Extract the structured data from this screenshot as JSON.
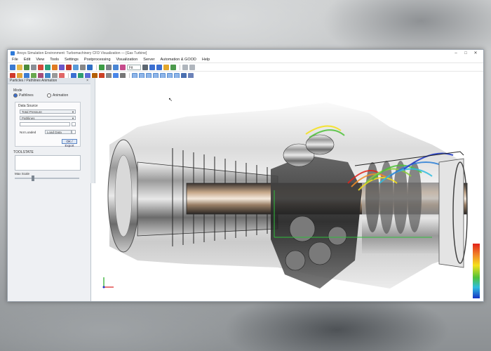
{
  "window": {
    "title": "Ansys Simulation Environment: Turbomachinery CFD Visualization — [Gas Turbine]",
    "controls": {
      "minimize": "–",
      "maximize": "□",
      "close": "✕"
    }
  },
  "menu": [
    "File",
    "Edit",
    "View",
    "Tools",
    "Settings",
    "Postprocessing",
    "Visualization",
    "Server",
    "Automation & GOOD",
    "Help"
  ],
  "toolbar": {
    "dropdown_value": "Fit"
  },
  "left_panel": {
    "header": "Particles / Pathlines Animation",
    "close": "×",
    "mode_label": "Mode",
    "radio_options": [
      "Pathlines",
      "Animation"
    ],
    "data_source_label": "Data Source",
    "data_source_value": "Total Pressure",
    "second_field_value": "Pathlines",
    "not_loaded_label": "Not Loaded",
    "not_loaded_value": "Load Data",
    "ok_label": "OK / Export",
    "section_label": "TOOLSTATE",
    "slider_label": "Max Scale"
  },
  "colors": {
    "accent": "#3b6fd1",
    "colorbar_top": "#e2231a",
    "colorbar_bottom": "#1833c4"
  }
}
